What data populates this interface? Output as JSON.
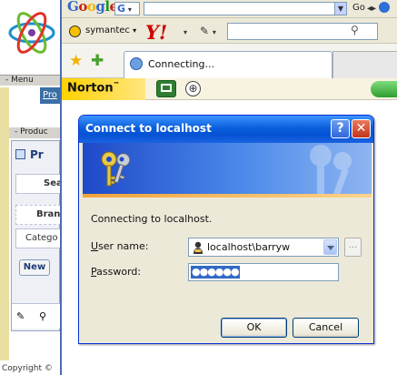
{
  "colors": {
    "title_bar": "#0a5fdc",
    "dialog_face": "#ece9d8",
    "selection": "#316ac5",
    "close_button": "#c2351b",
    "norton_yellow": "#ffd200",
    "yahoo_red": "#cc0000"
  },
  "background_page": {
    "menu_header": "- Menu",
    "menu_tab": "Pro",
    "product_header": "- Produc",
    "product_title": "Pr",
    "fields": [
      "Sea",
      "Bran",
      "Catego"
    ],
    "new_button": "New",
    "copyright": "Copyright ©"
  },
  "browser": {
    "google_toolbar": {
      "logo_letters": [
        "G",
        "o",
        "o",
        "g",
        "l",
        "e"
      ],
      "g_button": "G",
      "go_label": "Go"
    },
    "yahoo_toolbar": {
      "symantec_label": "symantec",
      "yahoo_logo": "Y!"
    },
    "tabs": [
      {
        "label": "Connecting...",
        "icon": "ie-page-icon"
      }
    ],
    "norton_toolbar": {
      "logo": "Norton",
      "logo_tm": "™"
    }
  },
  "dialog": {
    "title": "Connect to localhost",
    "help_glyph": "?",
    "close_glyph": "✕",
    "message": "Connecting to localhost.",
    "username_label_accel": "U",
    "username_label_rest": "ser name:",
    "username_value": "localhost\\barryw",
    "browse_label": "...",
    "password_label_accel": "P",
    "password_label_rest": "assword:",
    "password_value": "●●●●●●",
    "ok_label": "OK",
    "cancel_label": "Cancel"
  }
}
